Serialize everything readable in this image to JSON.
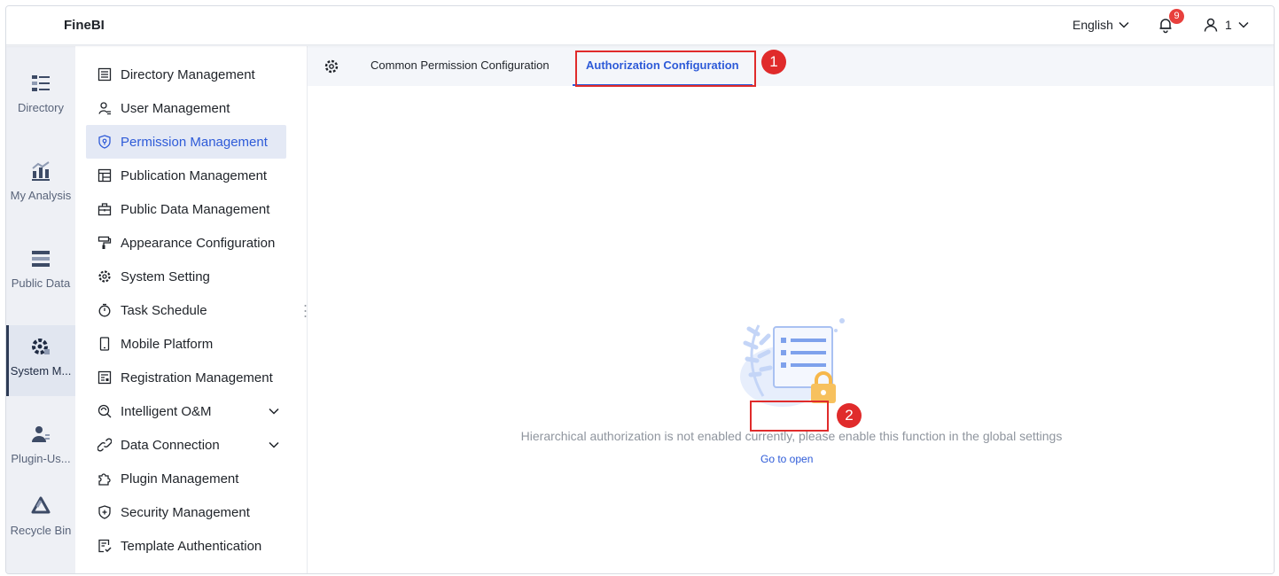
{
  "header": {
    "brand": "FineBI",
    "language": "English",
    "notification_count": "9",
    "user_name": "1"
  },
  "rail": {
    "items": [
      {
        "label": "Directory",
        "icon": "directory-icon"
      },
      {
        "label": "My Analysis",
        "icon": "analysis-chart-icon"
      },
      {
        "label": "Public Data",
        "icon": "database-icon"
      },
      {
        "label": "System M...",
        "icon": "system-gear-icon",
        "active": true
      },
      {
        "label": "Plugin-Us...",
        "icon": "plugin-user-icon"
      },
      {
        "label": "Recycle Bin",
        "icon": "recycle-bin-icon"
      }
    ]
  },
  "menu": {
    "items": [
      {
        "label": "Directory Management",
        "icon": "list-icon"
      },
      {
        "label": "User Management",
        "icon": "user-icon"
      },
      {
        "label": "Permission Management",
        "icon": "shield-icon",
        "active": true
      },
      {
        "label": "Publication Management",
        "icon": "publication-icon"
      },
      {
        "label": "Public Data Management",
        "icon": "briefcase-icon"
      },
      {
        "label": "Appearance Configuration",
        "icon": "paint-roller-icon"
      },
      {
        "label": "System Setting",
        "icon": "gear-icon"
      },
      {
        "label": "Task Schedule",
        "icon": "timer-icon"
      },
      {
        "label": "Mobile Platform",
        "icon": "mobile-icon"
      },
      {
        "label": "Registration Management",
        "icon": "registration-icon"
      },
      {
        "label": "Intelligent O&M",
        "icon": "om-icon",
        "expandable": true
      },
      {
        "label": "Data Connection",
        "icon": "link-icon",
        "expandable": true
      },
      {
        "label": "Plugin Management",
        "icon": "puzzle-icon"
      },
      {
        "label": "Security Management",
        "icon": "security-shield-icon"
      },
      {
        "label": "Template Authentication",
        "icon": "template-auth-icon"
      }
    ]
  },
  "tabs": {
    "common": "Common Permission Configuration",
    "authorization": "Authorization Configuration"
  },
  "panel": {
    "message": "Hierarchical authorization is not enabled currently, please enable this function in the global settings",
    "link": "Go to open"
  },
  "annotations": {
    "step1": "1",
    "step2": "2"
  },
  "colors": {
    "accent": "#2e5bd8",
    "annotation": "#e02b2b",
    "badge": "#e8403d"
  }
}
